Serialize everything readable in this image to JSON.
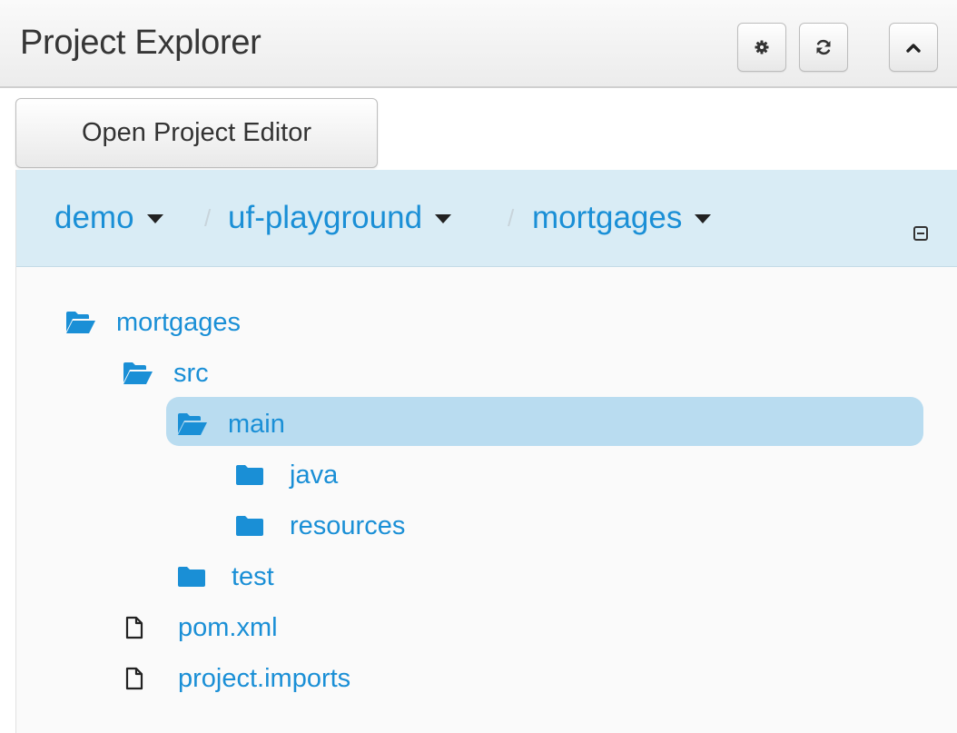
{
  "header": {
    "title": "Project Explorer",
    "buttons": [
      {
        "name": "settings-button",
        "icon": "gear-icon"
      },
      {
        "name": "refresh-button",
        "icon": "refresh-icon"
      },
      {
        "name": "collapse-panel-button",
        "icon": "chevron-up-icon"
      }
    ]
  },
  "toolbar": {
    "open_project_editor_label": "Open Project Editor"
  },
  "breadcrumb": {
    "items": [
      {
        "label": "demo"
      },
      {
        "label": "uf-playground"
      },
      {
        "label": "mortgages"
      }
    ],
    "separator": "/"
  },
  "tree": {
    "items": [
      {
        "label": "mortgages",
        "type": "folder-open",
        "depth": 0
      },
      {
        "label": "src",
        "type": "folder-open",
        "depth": 1
      },
      {
        "label": "main",
        "type": "folder-open",
        "depth": 2,
        "selected": true
      },
      {
        "label": "java",
        "type": "folder",
        "depth": 3
      },
      {
        "label": "resources",
        "type": "folder",
        "depth": 3
      },
      {
        "label": "test",
        "type": "folder",
        "depth": 2
      },
      {
        "label": "pom.xml",
        "type": "file",
        "depth": 1
      },
      {
        "label": "project.imports",
        "type": "file",
        "depth": 1
      }
    ]
  },
  "colors": {
    "link": "#1a8fd6",
    "breadcrumb_bg": "#d9ecf5",
    "selection_bg": "#b9dcf0",
    "folder": "#1a8fd6"
  }
}
